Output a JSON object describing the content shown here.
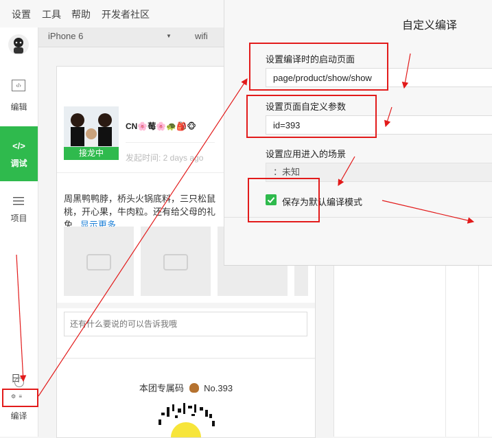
{
  "menubar": {
    "items": [
      "设置",
      "工具",
      "帮助",
      "开发者社区"
    ]
  },
  "sidebar": {
    "items": [
      {
        "label": "编辑",
        "icon": "code-file-icon"
      },
      {
        "label": "调试",
        "icon": "code-icon"
      },
      {
        "label": "项目",
        "icon": "menu-icon"
      },
      {
        "label": "编译",
        "icon": "compile-icon"
      }
    ],
    "partial_text": "日"
  },
  "simulator": {
    "device": "iPhone 6",
    "network": "wifi"
  },
  "post": {
    "username": "CN🌸莓🌸🐢🎒🐵",
    "time": "发起时间: 2 days ago",
    "badge": "接龙中",
    "body": "周黑鸭鸭脖，桥头火锅底料，三只松鼠\n桃，开心果，牛肉粒。还有给父母的礼\n免...",
    "show_more": "显示更多",
    "comment_placeholder": "还有什么要说的可以告诉我哦",
    "group_code_label": "本团专属码",
    "group_code": "No.393"
  },
  "dialog": {
    "title": "自定义编译",
    "field1_label": "设置编译时的启动页面",
    "field1_value": "page/product/show/show",
    "field2_label": "设置页面自定义参数",
    "field2_value": "id=393",
    "field3_label": "设置应用进入的场景",
    "field3_value": "：未知",
    "checkbox_label": "保存为默认编译模式",
    "checkbox_checked": true
  },
  "colors": {
    "accent": "#2fba4d",
    "annotation": "#e21a1a",
    "link": "#1a7ed6"
  }
}
